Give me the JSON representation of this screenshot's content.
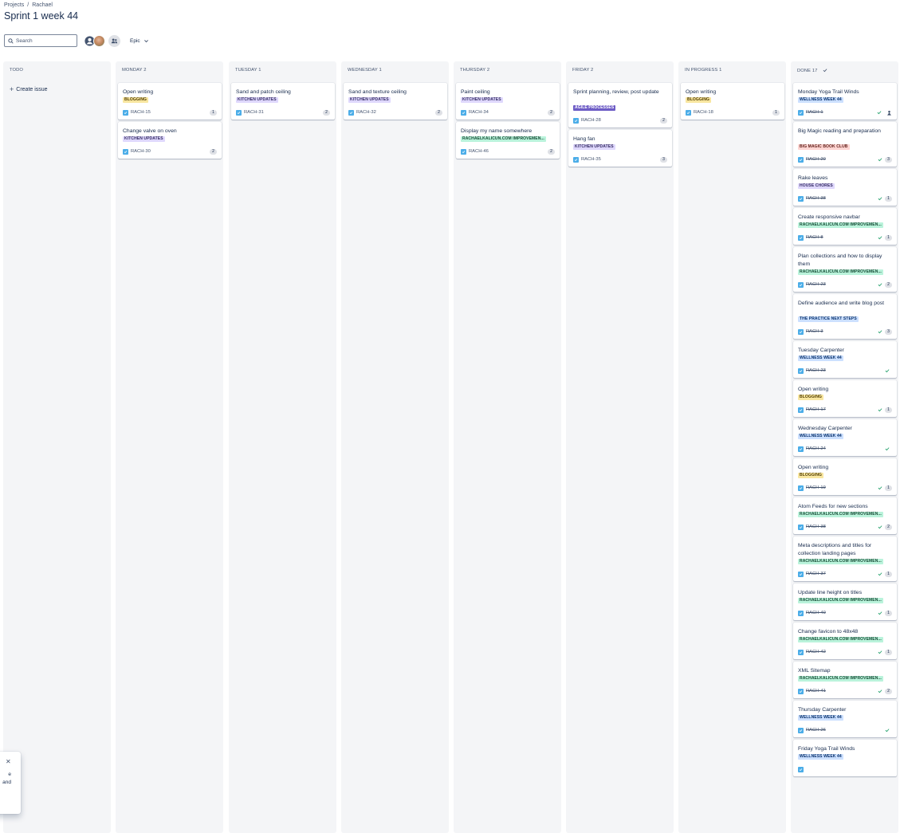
{
  "breadcrumb": {
    "items": [
      "Projects",
      "/",
      "Rachael"
    ]
  },
  "page": {
    "title": "Sprint 1 week 44"
  },
  "toolbar": {
    "search_placeholder": "Search",
    "epic_label": "Epic",
    "icons": [
      "search-icon",
      "user-icon",
      "add-people-icon",
      "chevron-down-icon"
    ]
  },
  "colors": {
    "blogging": "#f8e6a0",
    "kitchen_updates": "#dfd8fd",
    "rachaelkalicun": "#baf3db",
    "agile_processes": "#6e5dc6",
    "wellness_week_44": "#cce0ff",
    "big_magic_book_club": "#ffd5d2",
    "house_chores": "#dfd8fd",
    "practice_next_steps": "#cce0ff",
    "story": "#4bade8"
  },
  "columns": [
    {
      "header": "TODO",
      "create_label": "Create issue",
      "cards": []
    },
    {
      "header": "MONDAY 2",
      "cards": [
        {
          "title": "Open writing",
          "epic": "BLOGGING",
          "epic_kind": "blogging",
          "key": "RACH-15",
          "points": "1"
        },
        {
          "title": "Change valve on oven",
          "epic": "KITCHEN UPDATES",
          "epic_kind": "kitchen",
          "key": "RACH-30",
          "points": "2"
        }
      ]
    },
    {
      "header": "TUESDAY 1",
      "cards": [
        {
          "title": "Sand and patch ceiling",
          "epic": "KITCHEN UPDATES",
          "epic_kind": "kitchen",
          "key": "RACH-31",
          "points": "2"
        }
      ]
    },
    {
      "header": "WEDNESDAY 1",
      "cards": [
        {
          "title": "Sand and texture ceiling",
          "epic": "KITCHEN UPDATES",
          "epic_kind": "kitchen",
          "key": "RACH-32",
          "points": "2"
        }
      ]
    },
    {
      "header": "THURSDAY 2",
      "cards": [
        {
          "title": "Paint ceiling",
          "epic": "KITCHEN UPDATES",
          "epic_kind": "kitchen",
          "key": "RACH-34",
          "points": "2"
        },
        {
          "title": "Display my name somewhere",
          "epic": "RACHAELKALICUN.COM IMPROVEMEN...",
          "epic_kind": "site",
          "key": "RACH-46",
          "points": "2"
        }
      ]
    },
    {
      "header": "FRIDAY 2",
      "cards": [
        {
          "title": "Sprint planning, review, post update",
          "epic": "AGILE PROCESSES",
          "epic_kind": "agile",
          "key": "RACH-28",
          "points": "2"
        },
        {
          "title": "Hang fan",
          "epic": "KITCHEN UPDATES",
          "epic_kind": "kitchen",
          "key": "RACH-35",
          "points": "3"
        }
      ]
    },
    {
      "header": "IN PROGRESS 1",
      "cards": [
        {
          "title": "Open writing",
          "epic": "BLOGGING",
          "epic_kind": "blogging",
          "key": "RACH-18",
          "points": "1"
        }
      ]
    },
    {
      "header": "DONE 17",
      "cards": [
        {
          "title": "Monday Yoga Trail Winds",
          "epic": "WELLNESS WEEK 44",
          "epic_kind": "wellness",
          "key": "RACH-1",
          "points": "",
          "assignee": true
        },
        {
          "title": "Big Magic reading and preparation",
          "epic": "BIG MAGIC BOOK CLUB",
          "epic_kind": "bigmagic",
          "key": "RACH-20",
          "points": "3"
        },
        {
          "title": "Rake leaves",
          "epic": "HOUSE CHORES",
          "epic_kind": "house",
          "key": "RACH-38",
          "points": "1"
        },
        {
          "title": "Create responsive navbar",
          "epic": "RACHAELKALICUN.COM IMPROVEMEN...",
          "epic_kind": "site",
          "key": "RACH-8",
          "points": "1"
        },
        {
          "title": "Plan collections and how to display them",
          "epic": "RACHAELKALICUN.COM IMPROVEMEN...",
          "epic_kind": "site",
          "key": "RACH-23",
          "points": "2"
        },
        {
          "title": "Define audience and write blog post",
          "epic": "THE PRACTICE NEXT STEPS",
          "epic_kind": "practice",
          "key": "RACH-3",
          "points": "3"
        },
        {
          "title": "Tuesday Carpenter",
          "epic": "WELLNESS WEEK 44",
          "epic_kind": "wellness",
          "key": "RACH-23",
          "points": ""
        },
        {
          "title": "Open writing",
          "epic": "BLOGGING",
          "epic_kind": "blogging",
          "key": "RACH-17",
          "points": "1"
        },
        {
          "title": "Wednesday Carpenter",
          "epic": "WELLNESS WEEK 44",
          "epic_kind": "wellness",
          "key": "RACH-24",
          "points": ""
        },
        {
          "title": "Open writing",
          "epic": "BLOGGING",
          "epic_kind": "blogging",
          "key": "RACH-19",
          "points": "1"
        },
        {
          "title": "Atom Feeds for new sections",
          "epic": "RACHAELKALICUN.COM IMPROVEMEN...",
          "epic_kind": "site",
          "key": "RACH-38",
          "points": "2"
        },
        {
          "title": "Meta descriptions and titles for collection landing pages",
          "epic": "RACHAELKALICUN.COM IMPROVEMEN...",
          "epic_kind": "site",
          "key": "RACH-37",
          "points": "1"
        },
        {
          "title": "Update line height on titles",
          "epic": "RACHAELKALICUN.COM IMPROVEMEN...",
          "epic_kind": "site",
          "key": "RACH-40",
          "points": "1"
        },
        {
          "title": "Change favicon to 48x48",
          "epic": "RACHAELKALICUN.COM IMPROVEMEN...",
          "epic_kind": "site",
          "key": "RACH-42",
          "points": "1"
        },
        {
          "title": "XML Sitemap",
          "epic": "RACHAELKALICUN.COM IMPROVEMEN...",
          "epic_kind": "site",
          "key": "RACH-41",
          "points": "2"
        },
        {
          "title": "Thursday Carpenter",
          "epic": "WELLNESS WEEK 44",
          "epic_kind": "wellness",
          "key": "RACH-26",
          "points": ""
        },
        {
          "title": "Friday Yoga Trail Winds",
          "epic": "WELLNESS WEEK 44",
          "epic_kind": "wellness",
          "key": "",
          "points": ""
        }
      ]
    }
  ],
  "popup": {
    "text_lines": [
      "e",
      "and"
    ],
    "close_icon": "close-icon"
  }
}
